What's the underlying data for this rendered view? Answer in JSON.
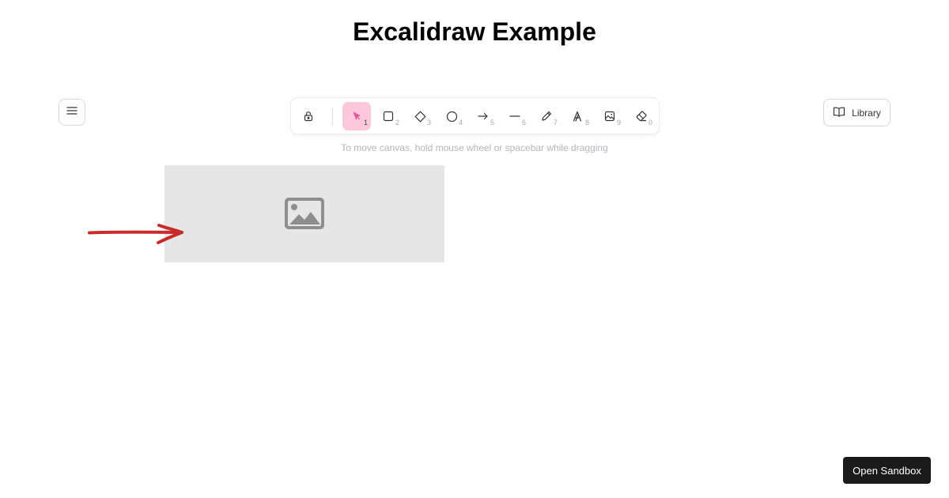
{
  "page": {
    "title": "Excalidraw Example"
  },
  "toolbar": {
    "tools": [
      {
        "name": "lock",
        "icon": "lock-icon",
        "key": ""
      },
      {
        "name": "selection",
        "icon": "cursor-icon",
        "key": "1",
        "active": true
      },
      {
        "name": "rectangle",
        "icon": "rectangle-icon",
        "key": "2"
      },
      {
        "name": "diamond",
        "icon": "diamond-icon",
        "key": "3"
      },
      {
        "name": "ellipse",
        "icon": "circle-icon",
        "key": "4"
      },
      {
        "name": "arrow",
        "icon": "arrow-icon",
        "key": "5"
      },
      {
        "name": "line",
        "icon": "line-icon",
        "key": "6"
      },
      {
        "name": "draw",
        "icon": "pencil-icon",
        "key": "7"
      },
      {
        "name": "text",
        "icon": "text-icon",
        "key": "8"
      },
      {
        "name": "image",
        "icon": "image-icon",
        "key": "9"
      },
      {
        "name": "eraser",
        "icon": "eraser-icon",
        "key": "0"
      }
    ],
    "active_color": "#fdc8dc",
    "active_icon_color": "#e8559a"
  },
  "hint": {
    "text": "To move canvas, hold mouse wheel or spacebar while dragging"
  },
  "library": {
    "label": "Library",
    "icon": "book-icon"
  },
  "menu": {
    "icon": "hamburger-icon"
  },
  "canvas": {
    "image_placeholder_icon": "image-icon",
    "arrow_color": "#c92a2a"
  },
  "sandbox": {
    "label": "Open Sandbox"
  }
}
